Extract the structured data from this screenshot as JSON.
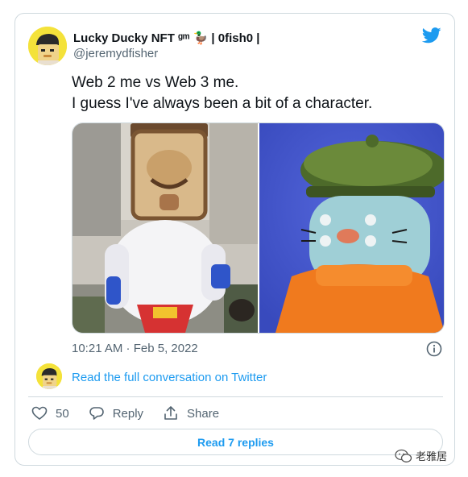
{
  "tweet": {
    "display_name": "Lucky Ducky NFT ᵍᵐ 🦆 | 0fish0 |",
    "handle": "@jeremydfisher",
    "text_lines": [
      "Web 2 me vs Web 3 me.",
      "I guess I've always been a bit of a character."
    ],
    "timestamp": "10:21 AM · Feb 5, 2022",
    "full_conversation_link": "Read the full conversation on Twitter",
    "likes": "50",
    "reply_label": "Reply",
    "share_label": "Share",
    "read_replies_label": "Read 7 replies"
  },
  "watermark": {
    "text": "老雅居"
  },
  "colors": {
    "accent": "#1d9bf0",
    "secondary_text": "#536471",
    "border": "#cfd9de",
    "avatar_bg": "#f4e23a"
  },
  "icons": [
    "twitter-bird-icon",
    "info-icon",
    "heart-icon",
    "reply-icon",
    "share-icon",
    "wechat-icon"
  ]
}
